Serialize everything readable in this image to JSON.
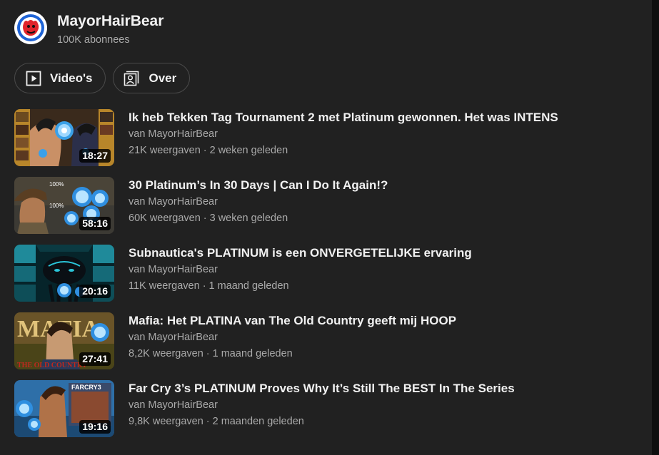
{
  "channel": {
    "name": "MayorHairBear",
    "subscribers": "100K abonnees",
    "avatar_icon": "bear-logo-icon"
  },
  "tabs": [
    {
      "label": "Video's",
      "icon": "play-box-icon"
    },
    {
      "label": "Over",
      "icon": "person-card-icon"
    }
  ],
  "videos": [
    {
      "title": "Ik heb Tekken Tag Tournament 2 met Platinum gewonnen. Het was INTENS",
      "channel": "van MayorHairBear",
      "views": "21K weergaven",
      "age": "2 weken geleden",
      "duration": "18:27"
    },
    {
      "title": "30 Platinum’s In 30 Days | Can I Do It Again!?",
      "channel": "van MayorHairBear",
      "views": "60K weergaven",
      "age": "3 weken geleden",
      "duration": "58:16",
      "thumb_text": [
        "100%",
        "100%"
      ]
    },
    {
      "title": "Subnautica's PLATINUM is een ONVERGETELIJKE ervaring",
      "channel": "van MayorHairBear",
      "views": "11K weergaven",
      "age": "1 maand geleden",
      "duration": "20:16"
    },
    {
      "title": "Mafia: Het PLATINA van The Old Country geeft mij HOOP",
      "channel": "van MayorHairBear",
      "views": "8,2K weergaven",
      "age": "1 maand geleden",
      "duration": "27:41",
      "thumb_text": [
        "MAFIA",
        "THE OLD COUNTRY"
      ]
    },
    {
      "title": "Far Cry 3’s PLATINUM Proves Why It’s Still The BEST In The Series",
      "channel": "van MayorHairBear",
      "views": "9,8K weergaven",
      "age": "2 maanden geleden",
      "duration": "19:16",
      "thumb_text": [
        "FARCRY3"
      ]
    }
  ],
  "colors": {
    "background": "#212121",
    "text_primary": "#f1f1f1",
    "text_secondary": "#aaaaaa",
    "tab_border": "#4a4a4a",
    "platinum_blue": "#3aa0e8"
  }
}
